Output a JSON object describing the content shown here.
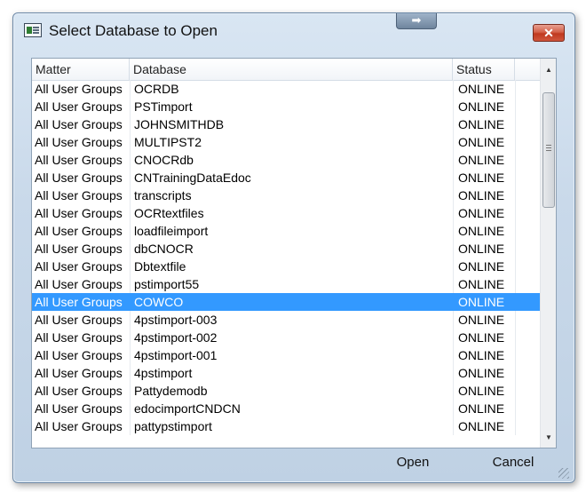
{
  "window": {
    "title": "Select Database to Open",
    "close_label": "✕",
    "nav_arrow": "➡"
  },
  "table": {
    "columns": [
      "Matter",
      "Database",
      "Status"
    ],
    "rows": [
      {
        "matter": "All User Groups",
        "database": "OCRDB",
        "status": "ONLINE"
      },
      {
        "matter": "All User Groups",
        "database": "PSTimport",
        "status": "ONLINE"
      },
      {
        "matter": "All User Groups",
        "database": "JOHNSMITHDB",
        "status": "ONLINE"
      },
      {
        "matter": "All User Groups",
        "database": "MULTIPST2",
        "status": "ONLINE"
      },
      {
        "matter": "All User Groups",
        "database": "CNOCRdb",
        "status": "ONLINE"
      },
      {
        "matter": "All User Groups",
        "database": "CNTrainingDataEdoc",
        "status": "ONLINE"
      },
      {
        "matter": "All User Groups",
        "database": "transcripts",
        "status": "ONLINE"
      },
      {
        "matter": "All User Groups",
        "database": "OCRtextfiles",
        "status": "ONLINE"
      },
      {
        "matter": "All User Groups",
        "database": "loadfileimport",
        "status": "ONLINE"
      },
      {
        "matter": "All User Groups",
        "database": "dbCNOCR",
        "status": "ONLINE"
      },
      {
        "matter": "All User Groups",
        "database": "Dbtextfile",
        "status": "ONLINE"
      },
      {
        "matter": "All User Groups",
        "database": "pstimport55",
        "status": "ONLINE"
      },
      {
        "matter": "All User Groups",
        "database": "COWCO",
        "status": "ONLINE",
        "selected": true
      },
      {
        "matter": "All User Groups",
        "database": "4pstimport-003",
        "status": "ONLINE"
      },
      {
        "matter": "All User Groups",
        "database": "4pstimport-002",
        "status": "ONLINE"
      },
      {
        "matter": "All User Groups",
        "database": "4pstimport-001",
        "status": "ONLINE"
      },
      {
        "matter": "All User Groups",
        "database": "4pstimport",
        "status": "ONLINE"
      },
      {
        "matter": "All User Groups",
        "database": "Pattydemodb",
        "status": "ONLINE"
      },
      {
        "matter": "All User Groups",
        "database": "edocimportCNDCN",
        "status": "ONLINE"
      },
      {
        "matter": "All User Groups",
        "database": "pattypstimport",
        "status": "ONLINE"
      }
    ]
  },
  "scrollbar": {
    "up_icon": "▲",
    "down_icon": "▼"
  },
  "buttons": {
    "open_label": "Open",
    "cancel_label": "Cancel"
  },
  "colors": {
    "selection": "#3399ff"
  }
}
